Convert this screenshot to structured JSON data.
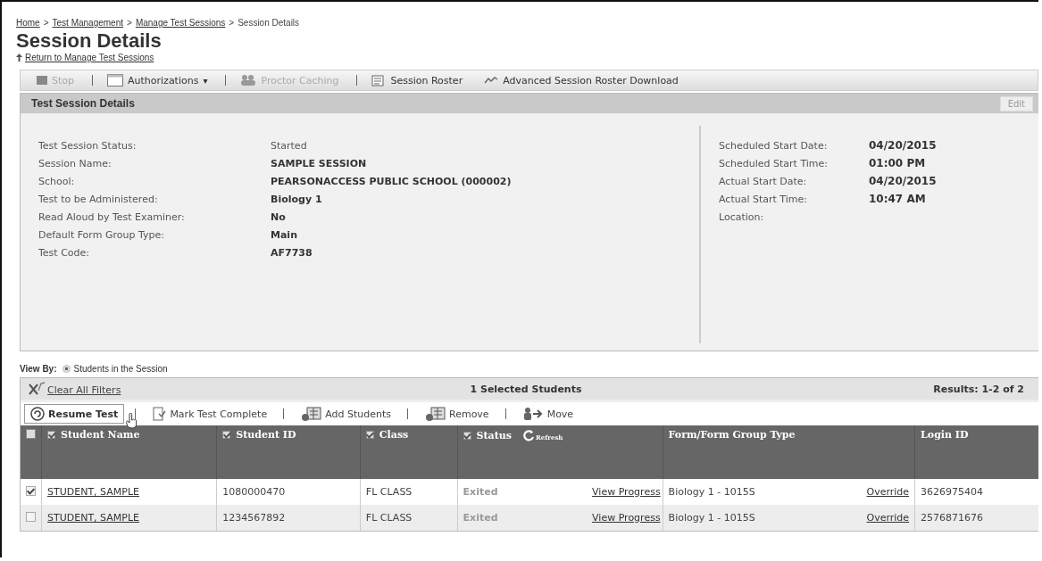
{
  "breadcrumb": {
    "separator": ">",
    "items": [
      {
        "label": "Home",
        "link": true
      },
      {
        "label": "Test Management",
        "link": true
      },
      {
        "label": "Manage Test Sessions",
        "link": true
      },
      {
        "label": "Session Details",
        "link": false
      }
    ]
  },
  "page_title": "Session Details",
  "return_link": "Return to Manage Test Sessions",
  "toolbar": [
    {
      "label": "Stop",
      "disabled": true,
      "dropdown": false
    },
    {
      "label": "Authorizations",
      "disabled": false,
      "dropdown": true,
      "caret": "▾"
    },
    {
      "label": "Proctor Caching",
      "disabled": true,
      "dropdown": false
    },
    {
      "label": "Session Roster",
      "disabled": false,
      "dropdown": false
    },
    {
      "label": "Advanced Session Roster Download",
      "disabled": false,
      "dropdown": false
    }
  ],
  "details_panel": {
    "title": "Test Session Details",
    "edit_button": "Edit",
    "left": [
      {
        "label": "Test Session Status:",
        "value": "Started",
        "bold": false
      },
      {
        "label": "Session Name:",
        "value": "SAMPLE SESSION",
        "bold": true
      },
      {
        "label": "School:",
        "value": "PEARSONACCESS PUBLIC SCHOOL (000002)",
        "bold": true
      },
      {
        "label": "Test to be Administered:",
        "value": "Biology 1",
        "bold": true
      },
      {
        "label": "Read Aloud by Test Examiner:",
        "value": "No",
        "bold": true
      },
      {
        "label": "Default Form Group Type:",
        "value": "Main",
        "bold": true
      },
      {
        "label": "Test Code:",
        "value": "AF7738",
        "bold": true
      }
    ],
    "right": [
      {
        "label": "Scheduled Start Date:",
        "value": "04/20/2015"
      },
      {
        "label": "Scheduled Start Time:",
        "value": "01:00 PM"
      },
      {
        "label": "Actual Start Date:",
        "value": "04/20/2015"
      },
      {
        "label": "Actual Start Time:",
        "value": "10:47 AM"
      },
      {
        "label": "Location:"
      }
    ]
  },
  "view_by": {
    "label": "View By:",
    "options": [
      {
        "label": "Students in the Session",
        "selected": true
      }
    ]
  },
  "filter_bar": {
    "clear_filters": "Clear All Filters",
    "selected_count": "1 Selected Students",
    "results": "Results: 1-2 of 2"
  },
  "actions": [
    {
      "label": "Resume Test",
      "primary": true
    },
    {
      "label": "Mark Test Complete",
      "primary": false
    },
    {
      "label": "Add Students",
      "primary": false
    },
    {
      "label": "Remove",
      "primary": false
    },
    {
      "label": "Move",
      "primary": false
    }
  ],
  "table": {
    "select_all_checked": false,
    "columns": [
      {
        "label": "Student Name",
        "kind": "toggle",
        "checked": true
      },
      {
        "label": "Student ID",
        "kind": "toggle",
        "checked": true
      },
      {
        "label": "Class",
        "kind": "toggle",
        "checked": true
      },
      {
        "label": "Status",
        "kind": "toggle",
        "checked": true,
        "refresh": "Refresh"
      },
      {
        "label": "Form/Form Group Type",
        "kind": "plain"
      },
      {
        "label": "Login ID",
        "kind": "plain"
      }
    ],
    "rows": [
      {
        "checked": true,
        "name": "STUDENT, SAMPLE",
        "id": "1080000470",
        "class": "FL CLASS",
        "status": "Exited",
        "progress_link": "View Progress",
        "form": "Biology 1 - 1015S",
        "override_link": "Override",
        "login_id": "3626975404"
      },
      {
        "checked": false,
        "name": "STUDENT, SAMPLE",
        "id": "1234567892",
        "class": "FL CLASS",
        "status": "Exited",
        "progress_link": "View Progress",
        "form": "Biology 1 - 1015S",
        "override_link": "Override",
        "login_id": "2576871676"
      }
    ]
  }
}
